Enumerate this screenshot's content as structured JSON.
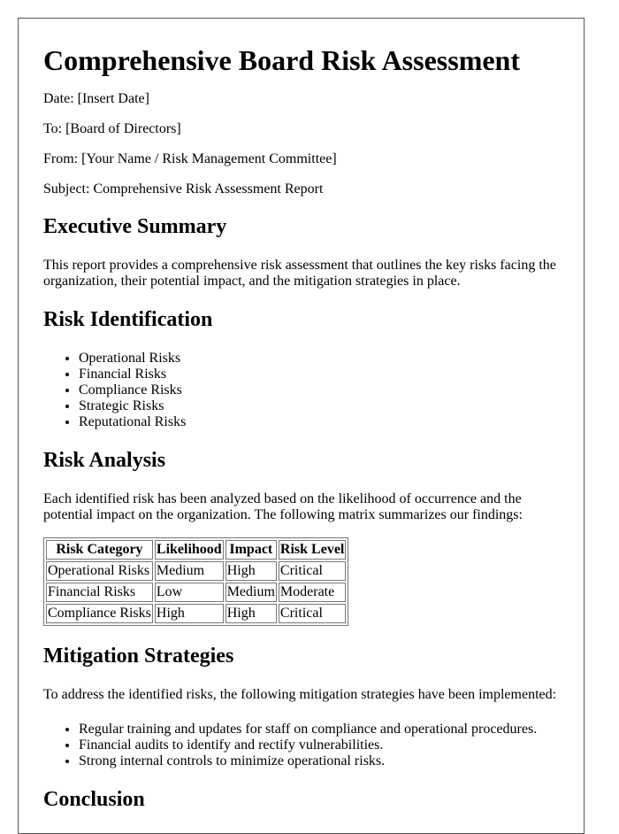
{
  "document": {
    "title": "Comprehensive Board Risk Assessment",
    "meta": {
      "date": "Date: [Insert Date]",
      "to": "To: [Board of Directors]",
      "from": "From: [Your Name / Risk Management Committee]",
      "subject": "Subject: Comprehensive Risk Assessment Report"
    },
    "executive_summary": {
      "heading": "Executive Summary",
      "text": "This report provides a comprehensive risk assessment that outlines the key risks facing the organization, their potential impact, and the mitigation strategies in place."
    },
    "risk_identification": {
      "heading": "Risk Identification",
      "items": [
        "Operational Risks",
        "Financial Risks",
        "Compliance Risks",
        "Strategic Risks",
        "Reputational Risks"
      ]
    },
    "risk_analysis": {
      "heading": "Risk Analysis",
      "text": "Each identified risk has been analyzed based on the likelihood of occurrence and the potential impact on the organization. The following matrix summarizes our findings:",
      "table": {
        "headers": [
          "Risk Category",
          "Likelihood",
          "Impact",
          "Risk Level"
        ],
        "rows": [
          [
            "Operational Risks",
            "Medium",
            "High",
            "Critical"
          ],
          [
            "Financial Risks",
            "Low",
            "Medium",
            "Moderate"
          ],
          [
            "Compliance Risks",
            "High",
            "High",
            "Critical"
          ]
        ]
      }
    },
    "mitigation": {
      "heading": "Mitigation Strategies",
      "text": "To address the identified risks, the following mitigation strategies have been implemented:",
      "items": [
        "Regular training and updates for staff on compliance and operational procedures.",
        "Financial audits to identify and rectify vulnerabilities.",
        "Strong internal controls to minimize operational risks."
      ]
    },
    "conclusion": {
      "heading": "Conclusion"
    }
  }
}
